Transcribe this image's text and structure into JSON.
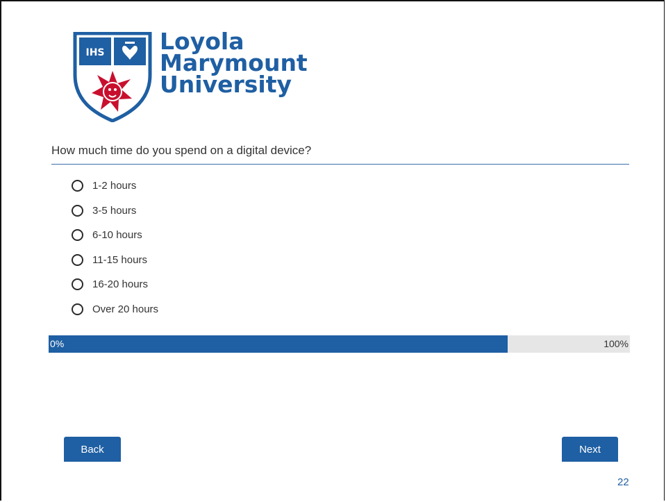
{
  "logo": {
    "line1": "Loyola",
    "line2": "Marymount",
    "line3": "University",
    "emblem_text": "IHS",
    "icon": "lmu-shield-crest-icon"
  },
  "survey": {
    "question": "How much time do you spend on a digital device?",
    "options": [
      "1-2 hours",
      "3-5 hours",
      "6-10 hours",
      "11-15 hours",
      "16-20 hours",
      "Over 20 hours"
    ]
  },
  "progress": {
    "start_label": "0%",
    "end_label": "100%",
    "fraction": 0.79
  },
  "buttons": {
    "back": "Back",
    "next": "Next"
  },
  "slide_number": "22",
  "colors": {
    "brand_blue": "#1f5fa3",
    "crest_red": "#c8102e",
    "track_gray": "#e6e6e6"
  }
}
